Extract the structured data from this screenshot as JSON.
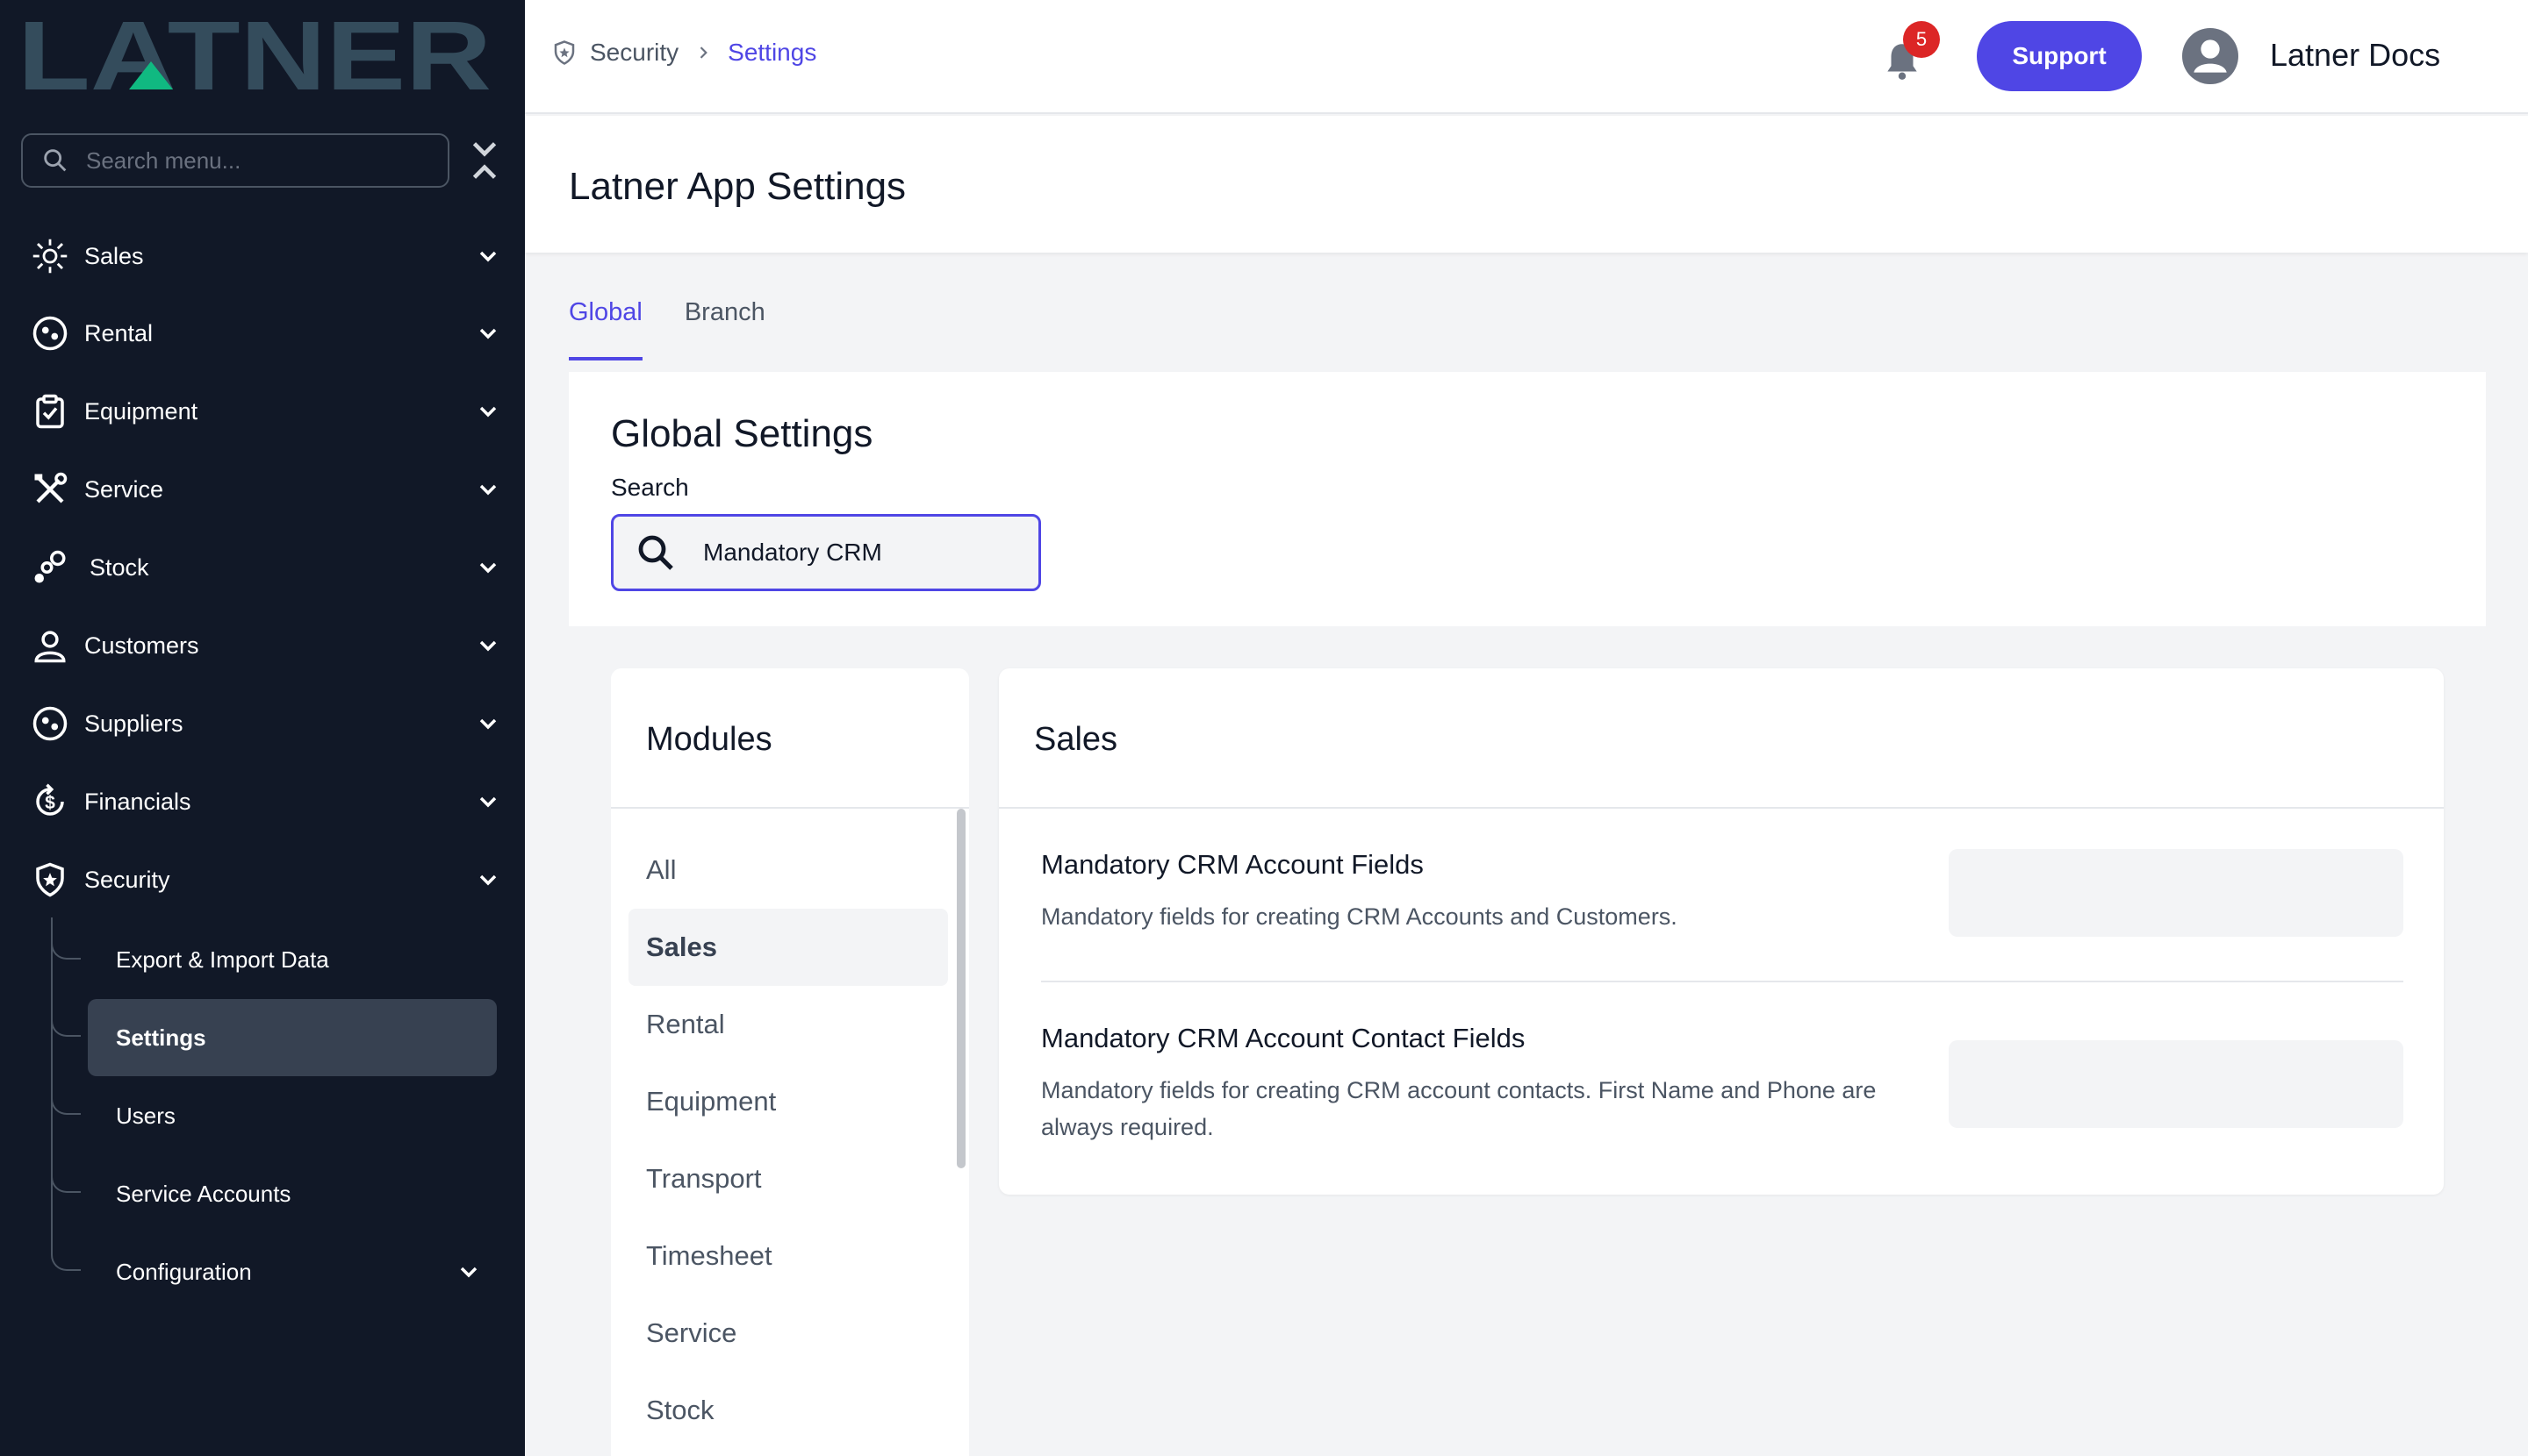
{
  "brand": {
    "logo_text": "LATNER",
    "logo_color": "#344c5c",
    "accent_triangle": "#10b981"
  },
  "sidebar": {
    "search_placeholder": "Search menu...",
    "items": [
      {
        "label": "Sales",
        "icon": "sales-icon"
      },
      {
        "label": "Rental",
        "icon": "rental-icon"
      },
      {
        "label": "Equipment",
        "icon": "clipboard-icon"
      },
      {
        "label": "Service",
        "icon": "tools-icon"
      },
      {
        "label": "Stock",
        "icon": "stock-icon"
      },
      {
        "label": "Customers",
        "icon": "user-icon"
      },
      {
        "label": "Suppliers",
        "icon": "supplier-icon"
      },
      {
        "label": "Financials",
        "icon": "dollar-icon"
      },
      {
        "label": "Security",
        "icon": "shield-icon"
      }
    ],
    "security_sub": [
      {
        "label": "Export & Import Data"
      },
      {
        "label": "Settings"
      },
      {
        "label": "Users"
      },
      {
        "label": "Service Accounts"
      },
      {
        "label": "Configuration"
      }
    ]
  },
  "header": {
    "breadcrumb_section": "Security",
    "breadcrumb_current": "Settings",
    "notification_count": "5",
    "support_label": "Support",
    "docs_label": "Latner Docs"
  },
  "page": {
    "title": "Latner App Settings",
    "tabs": [
      {
        "label": "Global"
      },
      {
        "label": "Branch"
      }
    ]
  },
  "global_settings": {
    "title": "Global Settings",
    "search_label": "Search",
    "search_value": "Mandatory CRM"
  },
  "modules": {
    "title": "Modules",
    "items": [
      "All",
      "Sales",
      "Rental",
      "Equipment",
      "Transport",
      "Timesheet",
      "Service",
      "Stock"
    ],
    "selected": "Sales"
  },
  "sales_panel": {
    "title": "Sales",
    "settings": [
      {
        "title": "Mandatory CRM Account Fields",
        "description": "Mandatory fields for creating CRM Accounts and Customers."
      },
      {
        "title": "Mandatory CRM Account Contact Fields",
        "description": "Mandatory fields for creating CRM account contacts. First Name and Phone are always required."
      }
    ]
  },
  "colors": {
    "primary": "#4f46e5",
    "sidebar_bg": "#111827",
    "badge": "#dc2626"
  }
}
